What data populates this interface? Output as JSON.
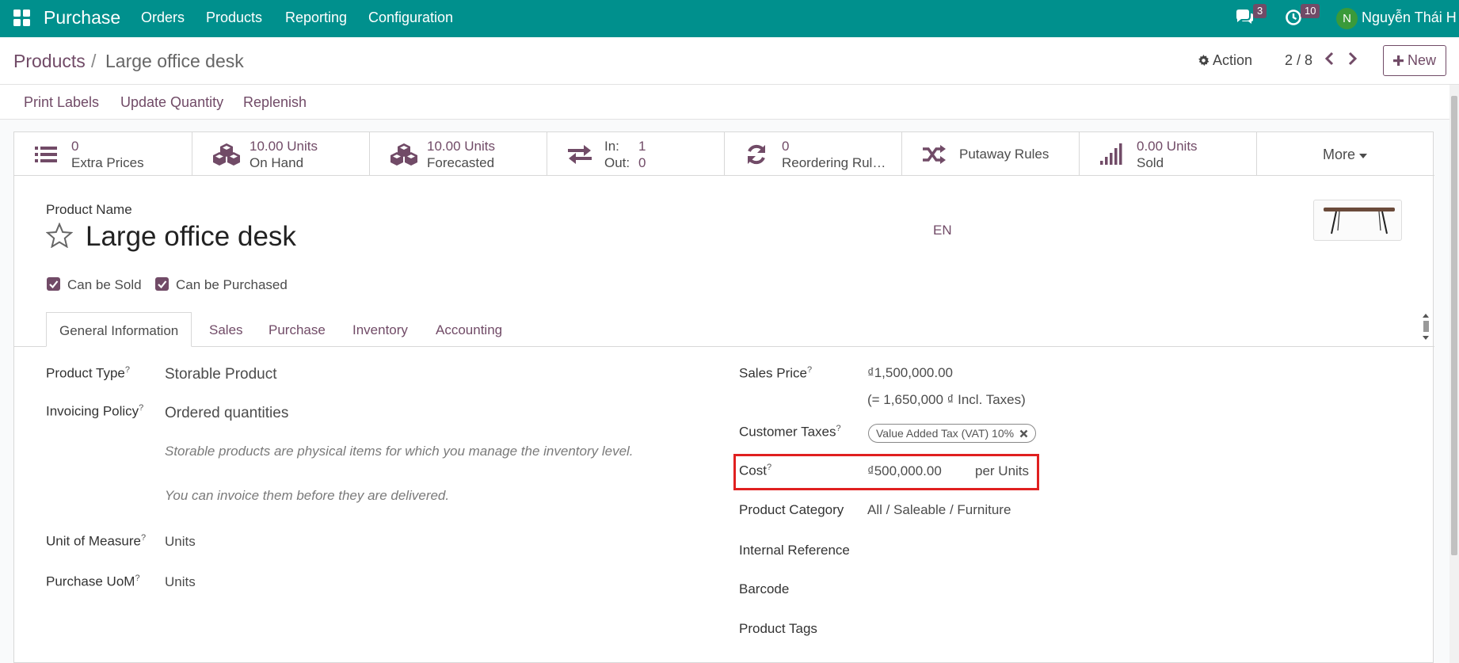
{
  "topbar": {
    "app_name": "Purchase",
    "menus": [
      "Orders",
      "Products",
      "Reporting",
      "Configuration"
    ],
    "messages_count": "3",
    "activities_count": "10",
    "avatar_initial": "N",
    "user_name": "Nguyễn Thái H",
    "bg_color": "#00908d"
  },
  "control_panel": {
    "breadcrumb_parent": "Products",
    "breadcrumb_sep": "/",
    "breadcrumb_current": "Large office desk",
    "action_label": "Action",
    "pager": "2 / 8",
    "new_label": "New"
  },
  "action_buttons": [
    "Print Labels",
    "Update Quantity",
    "Replenish"
  ],
  "smart_buttons": {
    "extra_prices": {
      "value": "0",
      "label": "Extra Prices",
      "icon": "list-icon"
    },
    "on_hand": {
      "value": "10.00 Units",
      "label": "On Hand",
      "icon": "cubes-icon"
    },
    "forecasted": {
      "value": "10.00 Units",
      "label": "Forecasted",
      "icon": "cubes-icon"
    },
    "in_out": {
      "in_label": "In:",
      "in_value": "1",
      "out_label": "Out:",
      "out_value": "0",
      "icon": "exchange-icon"
    },
    "reordering": {
      "value": "0",
      "label": "Reordering Rul…",
      "icon": "refresh-icon"
    },
    "putaway": {
      "label": "Putaway Rules",
      "icon": "random-icon"
    },
    "sold": {
      "value": "0.00 Units",
      "label": "Sold",
      "icon": "signal-icon"
    },
    "more": "More"
  },
  "product": {
    "name_label": "Product Name",
    "name": "Large office desk",
    "lang": "EN",
    "can_be_sold": "Can be Sold",
    "can_be_purchased": "Can be Purchased"
  },
  "tabs": [
    "General Information",
    "Sales",
    "Purchase",
    "Inventory",
    "Accounting"
  ],
  "left_fields": {
    "product_type_label": "Product Type",
    "product_type": "Storable Product",
    "invoicing_label": "Invoicing Policy",
    "invoicing": "Ordered quantities",
    "note1": "Storable products are physical items for which you manage the inventory level.",
    "note2": "You can invoice them before they are delivered.",
    "uom_label": "Unit of Measure",
    "uom": "Units",
    "purchase_uom_label": "Purchase UoM",
    "purchase_uom": "Units"
  },
  "right_fields": {
    "sales_price_label": "Sales Price",
    "sales_price": "₫1,500,000.00",
    "incl_taxes": "(= 1,650,000 ₫ Incl. Taxes)",
    "customer_taxes_label": "Customer Taxes",
    "customer_tax_tag": "Value Added Tax (VAT) 10%",
    "cost_label": "Cost",
    "cost": "₫500,000.00",
    "cost_unit": "per Units",
    "category_label": "Product Category",
    "category": "All / Saleable / Furniture",
    "internal_ref_label": "Internal Reference",
    "barcode_label": "Barcode",
    "tags_label": "Product Tags"
  },
  "help_marker": "?"
}
